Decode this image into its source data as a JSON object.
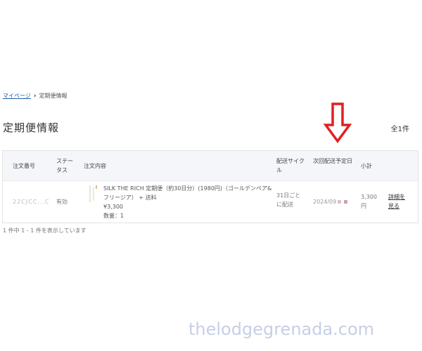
{
  "breadcrumb": {
    "mypage": "マイページ",
    "separator": "›",
    "current": "定期便情報"
  },
  "page": {
    "title": "定期便情報",
    "total": "全1件"
  },
  "table": {
    "headers": {
      "order_no": "注文番号",
      "status": "ステータス",
      "contents": "注文内容",
      "cycle": "配送サイクル",
      "next_date": "次回配送予定日",
      "subtotal": "小計"
    },
    "row": {
      "order_no": "22CJCC...C",
      "status": "有効",
      "product_name": "SILK THE RICH 定期便（約30日分）(1980円)（ゴールデンペア&フリージア） + 送料",
      "price": "¥3,300",
      "quantity": "数量：1",
      "cycle": "31日ごとに配送",
      "next_date": "2024/09",
      "subtotal": "3,300円",
      "detail": "詳細を見る"
    }
  },
  "summary": "1 件中 1 - 1 件を表示しています",
  "annotation": {
    "arrow_color": "#e02020"
  },
  "watermark": "thelodgegrenada.com"
}
